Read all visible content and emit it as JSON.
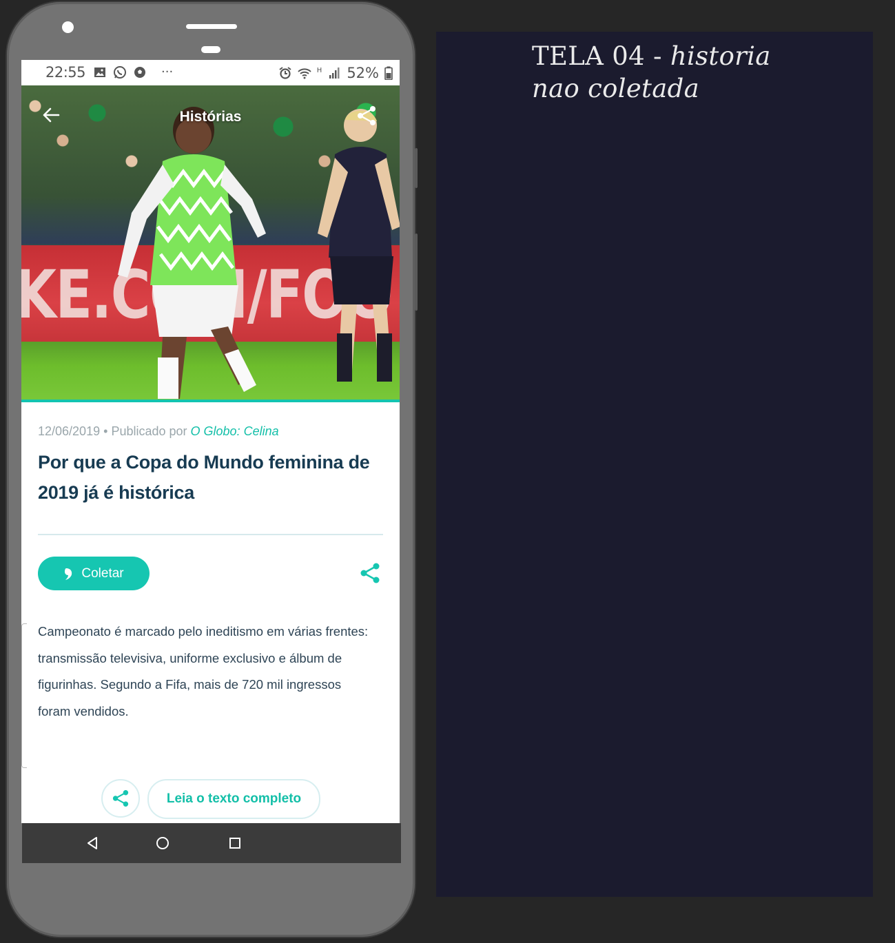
{
  "status_bar": {
    "time": "22:55",
    "more": "···",
    "battery": "52%",
    "network": "H"
  },
  "header": {
    "title": "Histórias"
  },
  "article": {
    "date": "12/06/2019",
    "separator": "•",
    "published_by_label": "Publicado por",
    "source": "O Globo: Celina",
    "headline": "Por que a Copa do Mundo feminina de 2019 já é histórica",
    "collect_label": "Coletar",
    "body": "Campeonato é marcado pelo ineditismo em várias frentes: transmissão televisiva, uniforme exclusivo e álbum de figurinhas. Segundo a Fifa, mais de 720 mil ingressos foram vendidos.",
    "read_full_label": "Leia o texto completo",
    "hero_board_text": "KE.COM/FOO"
  },
  "panel": {
    "title_plain": "TELA 04 - ",
    "title_italic_1": "historia",
    "title_italic_2": "nao coletada"
  },
  "colors": {
    "accent": "#16c6b1",
    "headline": "#173b52",
    "panel_bg": "#1b1b2e",
    "page_bg": "#262626"
  },
  "icons": [
    "back-arrow-icon",
    "share-icon",
    "collect-quote-icon",
    "nav-back-icon",
    "nav-home-icon",
    "nav-recents-icon"
  ]
}
